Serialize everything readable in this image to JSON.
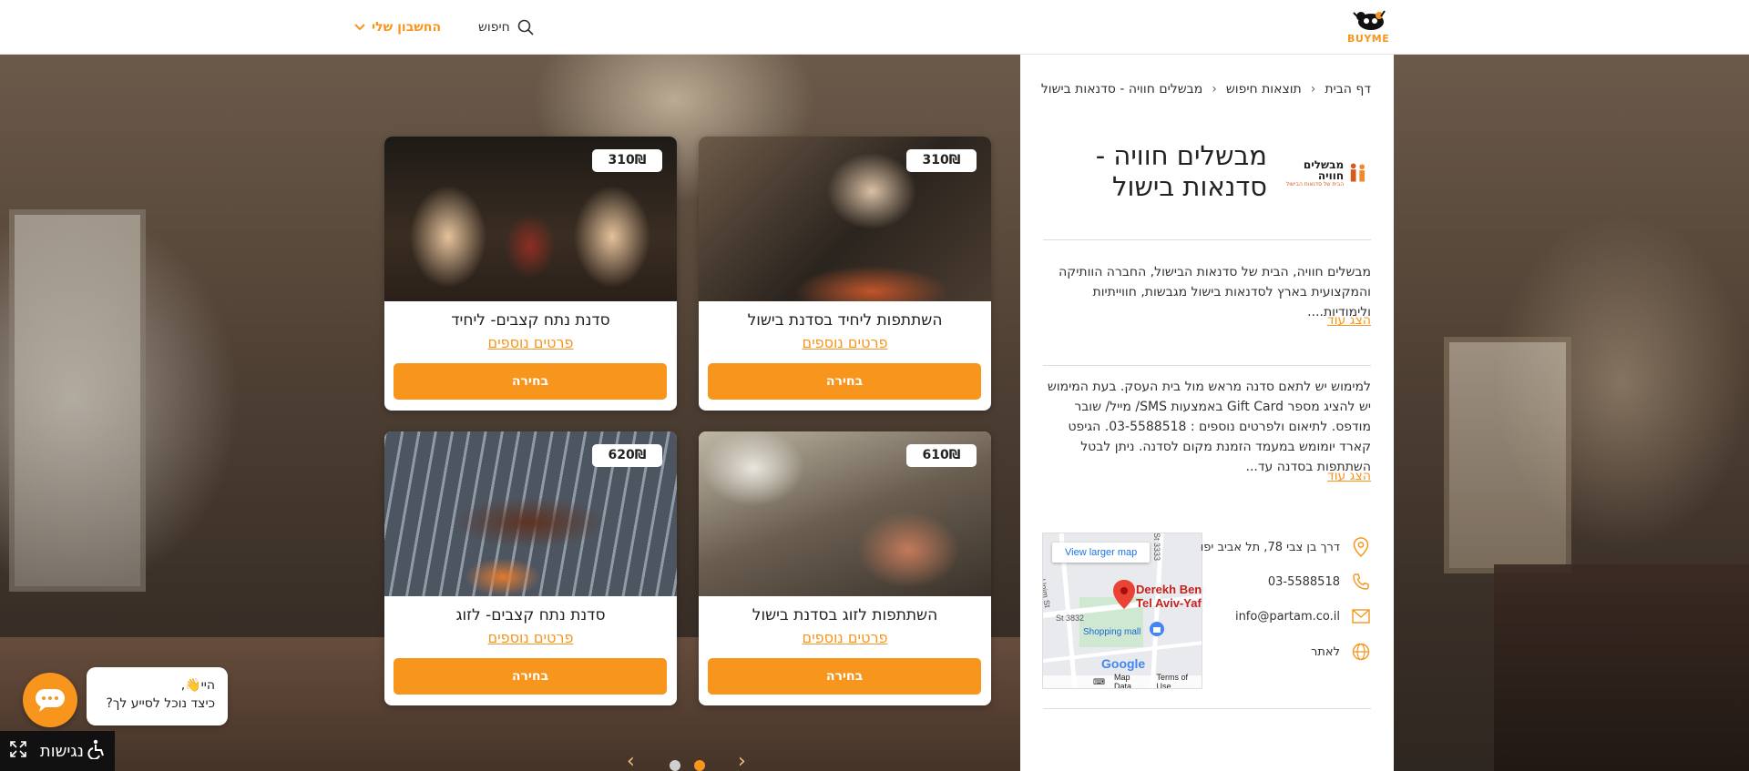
{
  "header": {
    "logo_text": "BUYME",
    "search_label": "חיפוש",
    "account_label": "החשבון שלי"
  },
  "breadcrumbs": [
    "דף הבית",
    "תוצאות חיפוש",
    "מבשלים חוויה - סדנאות בישול"
  ],
  "business": {
    "logo_name": "מבשלים חוויה",
    "logo_tagline": "הבית של סדנאות הבישול",
    "title": "מבשלים חוויה - סדנאות בישול",
    "description": "מבשלים חוויה, הבית של סדנאות הבישול, החברה הוותיקה והמקצועית בארץ לסדנאות בישול מגבשות, חווייתיות ולימודיות....",
    "terms": "למימוש יש לתאם סדנה מראש מול בית העסק. בעת המימוש יש להציג מספר Gift Card באמצעות SMS/ מייל/ שובר מודפס. לתיאום ולפרטים נוספים : 03-5588518. הגיפט קארד יומומש במעמד הזמנת מקום לסדנה. ניתן לבטל השתתפות בסדנה עד...",
    "show_more": "הצג עוד",
    "address": "דרך בן צבי 78, תל אביב יפו",
    "phone": "03-5588518",
    "email": "info@partam.co.il",
    "website": "לאתר"
  },
  "map": {
    "view_larger": "View larger map",
    "pin_label_1": "Derekh Ben-",
    "pin_label_2": "Tel Aviv-Yaf",
    "shopping": "Shopping mall",
    "street_1": "3832 St",
    "street_2": "3333 St",
    "street_3": "Unim St",
    "street_4": "ER",
    "google": "Google",
    "map_data": "Map Data",
    "terms": "Terms of Use"
  },
  "products": [
    {
      "title": "השתתפות ליחיד בסדנת בישול",
      "price": "310₪",
      "details": "פרטים נוספים",
      "choose": "בחירה"
    },
    {
      "title": "סדנת נתח קצבים- ליחיד",
      "price": "310₪",
      "details": "פרטים נוספים",
      "choose": "בחירה"
    },
    {
      "title": "השתתפות לזוג בסדנת בישול",
      "price": "610₪",
      "details": "פרטים נוספים",
      "choose": "בחירה"
    },
    {
      "title": "סדנת נתח קצבים- לזוג",
      "price": "620₪",
      "details": "פרטים נוספים",
      "choose": "בחירה"
    }
  ],
  "pagination": {
    "pages": 2,
    "active": 1
  },
  "chat": {
    "greeting": "היי👋,",
    "question": "כיצד נוכל לסייע לך?"
  },
  "accessibility": {
    "label": "נגישות"
  },
  "colors": {
    "accent": "#f7951d",
    "text": "#222222",
    "panel": "#ffffff"
  }
}
